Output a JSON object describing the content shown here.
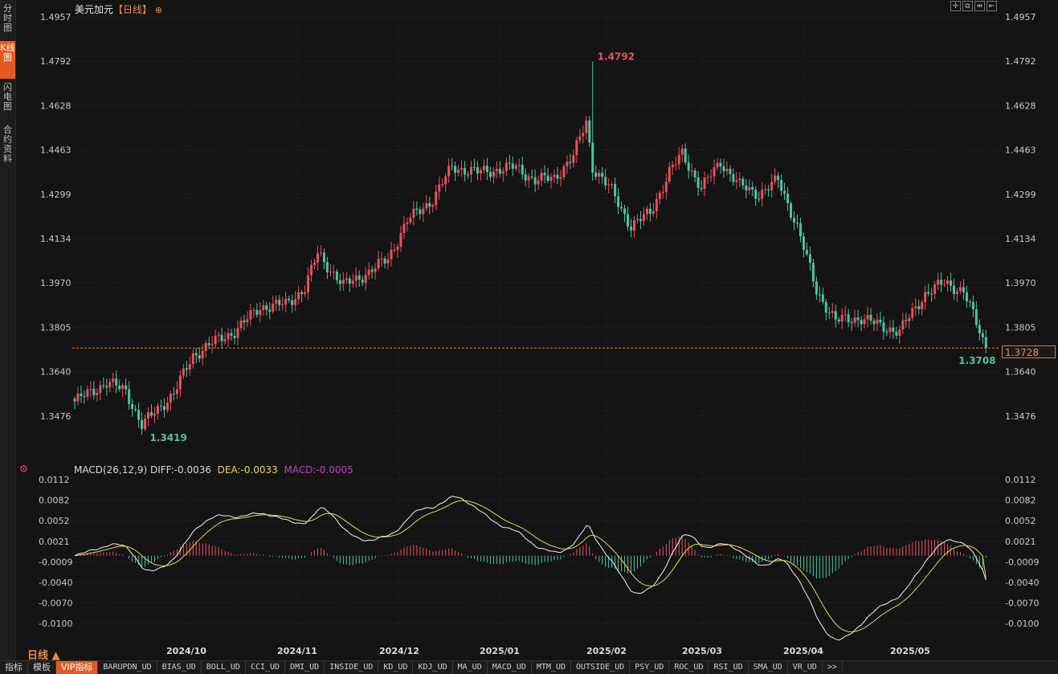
{
  "sidebar": {
    "tabs": [
      {
        "label": "分时图",
        "active": false
      },
      {
        "label": "K线图",
        "active": true
      },
      {
        "label": "闪电图",
        "active": false
      },
      {
        "label": "合约资料",
        "active": false
      }
    ]
  },
  "header": {
    "symbol": "美元加元",
    "period": "【日线】",
    "icon": "target-circle-icon"
  },
  "toolbar_icons": [
    "crosshair-icon",
    "zoom-in-icon",
    "zoom-out-icon",
    "first-page-icon"
  ],
  "price_axis": {
    "labels": [
      "1.4957",
      "1.4792",
      "1.4628",
      "1.4463",
      "1.4299",
      "1.4134",
      "1.3970",
      "1.3805",
      "1.3640",
      "1.3476"
    ],
    "last_price": "1.3728"
  },
  "annotations": {
    "high": "1.4792",
    "low": "1.3419",
    "last_low": "1.3708"
  },
  "macd_legend": {
    "name": "MACD(26,12,9)",
    "diff": "DIFF:-0.0036",
    "dea": "DEA:-0.0033",
    "macd": "MACD:-0.0005"
  },
  "macd_axis": {
    "labels": [
      "0.0112",
      "0.0082",
      "0.0052",
      "0.0021",
      "-0.0009",
      "-0.0040",
      "-0.0070",
      "-0.0100"
    ]
  },
  "date_axis": {
    "labels": [
      "2024/10",
      "2024/11",
      "2024/12",
      "2025/01",
      "2025/02",
      "2025/03",
      "2025/04",
      "2025/05"
    ]
  },
  "period_switch": {
    "label": "日线 ▲"
  },
  "bottom_tabs": [
    {
      "label": "指标",
      "kind": "cn"
    },
    {
      "label": "模板",
      "kind": "cn"
    },
    {
      "label": "VIP指标",
      "kind": "vip"
    },
    {
      "label": "BARUPDN_UD",
      "kind": "mono"
    },
    {
      "label": "BIAS_UD",
      "kind": "mono"
    },
    {
      "label": "BOLL_UD",
      "kind": "mono"
    },
    {
      "label": "CCI_UD",
      "kind": "mono"
    },
    {
      "label": "DMI_UD",
      "kind": "mono"
    },
    {
      "label": "INSIDE_UD",
      "kind": "mono"
    },
    {
      "label": "KD_UD",
      "kind": "mono"
    },
    {
      "label": "KDJ_UD",
      "kind": "mono"
    },
    {
      "label": "MA_UD",
      "kind": "mono"
    },
    {
      "label": "MACD_UD",
      "kind": "mono"
    },
    {
      "label": "MTM_UD",
      "kind": "mono"
    },
    {
      "label": "OUTSIDE_UD",
      "kind": "mono"
    },
    {
      "label": "PSY_UD",
      "kind": "mono"
    },
    {
      "label": "ROC_UD",
      "kind": "mono"
    },
    {
      "label": "RSI_UD",
      "kind": "mono"
    },
    {
      "label": "SMA_UD",
      "kind": "mono"
    },
    {
      "label": "VR_UD",
      "kind": "mono"
    },
    {
      "label": ">>",
      "kind": "mono"
    }
  ],
  "colors": {
    "up": "#e8505f",
    "down": "#4fc3a0",
    "diff_line": "#f2f2f2",
    "dea_line": "#e6d84a",
    "last_price_line": "#e07a20",
    "high_label": "#e8505f",
    "low_label": "#4fc3a0"
  },
  "chart_data": {
    "type": "candlestick",
    "title": "美元加元【日线】",
    "period_start": "2024/09",
    "period_end": "2025/05",
    "price_range": [
      1.335,
      1.4957
    ],
    "key_points": [
      {
        "label": "2024/09 open",
        "close": 1.356
      },
      {
        "label": "2024/09 low",
        "low": 1.3419
      },
      {
        "label": "2024/10",
        "close": 1.372
      },
      {
        "label": "2024/11",
        "close": 1.399
      },
      {
        "label": "2024/12",
        "close": 1.438
      },
      {
        "label": "2025/01",
        "close": 1.439
      },
      {
        "label": "2025/02 high",
        "high": 1.4792
      },
      {
        "label": "2025/02",
        "close": 1.419
      },
      {
        "label": "2025/03",
        "close": 1.434
      },
      {
        "label": "2025/04",
        "close": 1.386
      },
      {
        "label": "2025/05",
        "close": 1.395
      },
      {
        "label": "last",
        "close": 1.3728,
        "low": 1.3708
      }
    ],
    "macd": {
      "name": "MACD(26,12,9)",
      "diff_last": -0.0036,
      "dea_last": -0.0033,
      "macd_last": -0.0005,
      "range": [
        -0.0125,
        0.012
      ]
    }
  }
}
